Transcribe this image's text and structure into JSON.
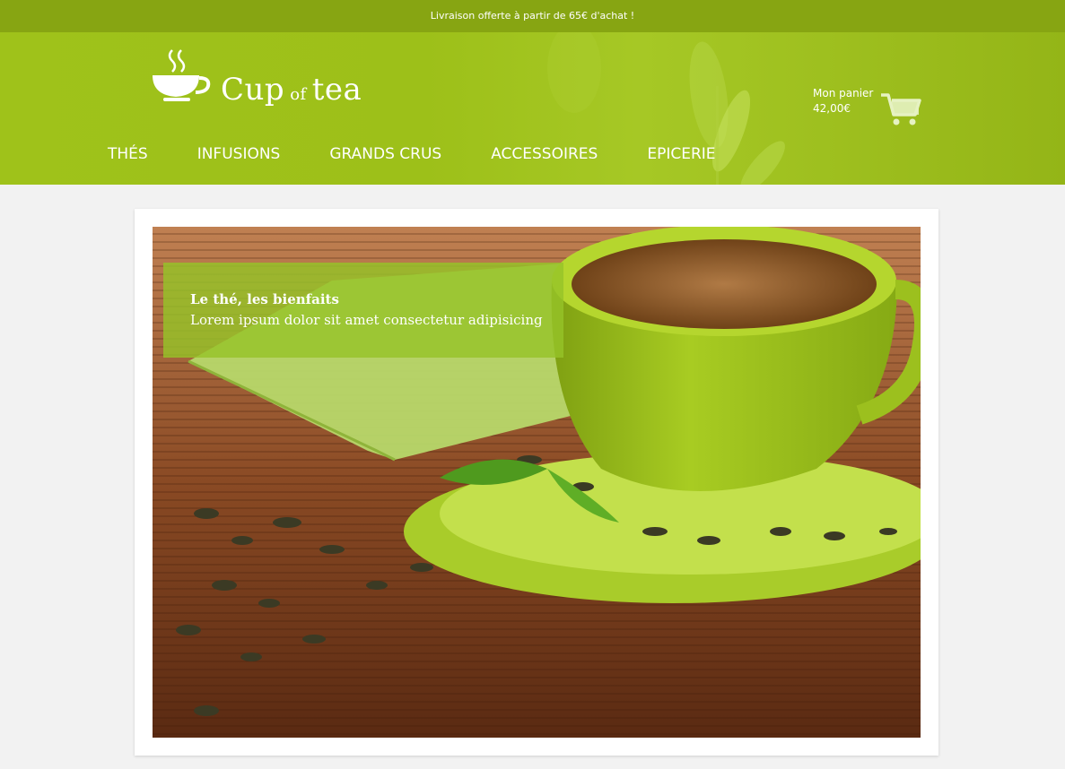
{
  "promo": {
    "text": "Livraison offerte à partir de 65€ d'achat !"
  },
  "logo": {
    "word1": "Cup",
    "word2": "of",
    "word3": "tea"
  },
  "cart": {
    "label": "Mon panier",
    "total": "42,00€"
  },
  "nav": {
    "items": [
      {
        "label": "THÉS"
      },
      {
        "label": "INFUSIONS"
      },
      {
        "label": "GRANDS CRUS"
      },
      {
        "label": "ACCESSOIRES"
      },
      {
        "label": "EPICERIE"
      }
    ]
  },
  "hero": {
    "title": "Le thé, les bienfaits",
    "subtitle": "Lorem ipsum dolor sit amet consectetur adipisicing"
  },
  "colors": {
    "header_green": "#9dc019",
    "promo_green": "#87a512",
    "caption_green": "#96c328",
    "page_bg": "#f2f2f2"
  },
  "icons": {
    "logo": "teacup-steam-icon",
    "cart": "shopping-cart-icon"
  }
}
